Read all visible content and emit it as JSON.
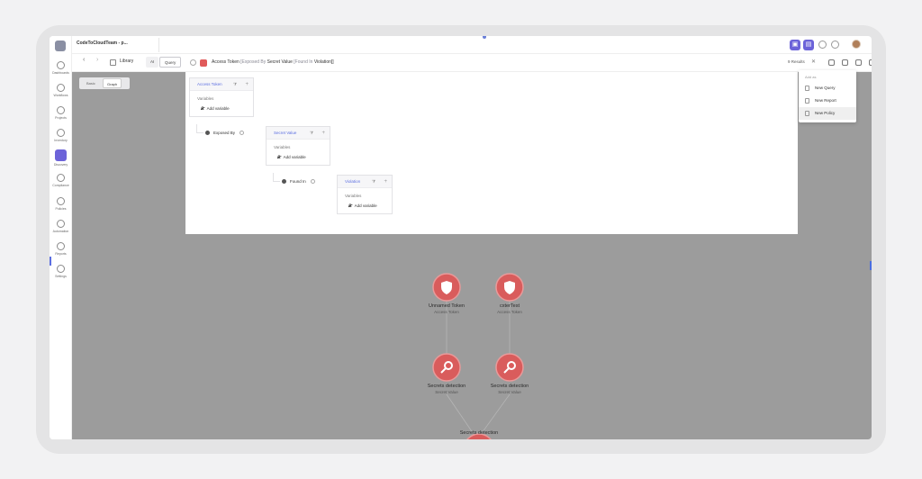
{
  "workspace": {
    "title": "CodeToCloudTeam - p..."
  },
  "sidebar": {
    "items": [
      {
        "label": "Dashboards",
        "icon": "dashboard-icon"
      },
      {
        "label": "Workflows",
        "icon": "workflow-icon"
      },
      {
        "label": "Projects",
        "icon": "projects-icon"
      },
      {
        "label": "Inventory",
        "icon": "inventory-icon"
      },
      {
        "label": "Discovery",
        "icon": "discovery-icon",
        "active": true
      },
      {
        "label": "Compliance",
        "icon": "compliance-icon"
      },
      {
        "label": "Policies",
        "icon": "policies-icon"
      },
      {
        "label": "Automation",
        "icon": "automation-icon"
      },
      {
        "label": "Reports",
        "icon": "reports-icon"
      },
      {
        "label": "Settings",
        "icon": "settings-icon"
      }
    ]
  },
  "toolbar": {
    "back": "‹",
    "forward": "›",
    "library": "Library",
    "ai": "AI",
    "query": "Query",
    "query_text": {
      "n1": "Access Token",
      "r1": "[Exposed By",
      "n2": "Secret Value",
      "r2": "[Found In",
      "n3": "Violation]]"
    },
    "results": "9 Results",
    "close": "✕"
  },
  "mode_tabs": {
    "basic": "Basic",
    "graph": "Graph"
  },
  "builder": {
    "nodes": [
      {
        "name": "Access Token",
        "variables_label": "Variables",
        "add_label": "Add variable"
      },
      {
        "name": "Secret Value",
        "variables_label": "Variables",
        "add_label": "Add variable"
      },
      {
        "name": "Violation",
        "variables_label": "Variables",
        "add_label": "Add variable"
      }
    ],
    "relations": [
      "Exposed By",
      "Found In"
    ]
  },
  "dropdown": {
    "title": "Add as",
    "items": [
      "New Query",
      "New Report",
      "New Policy"
    ]
  },
  "graph": {
    "nodes": [
      {
        "label": "Unnamed Token",
        "sub": "Access Token",
        "icon": "shield-icon"
      },
      {
        "label": "cxterTest",
        "sub": "Access Token",
        "icon": "shield-icon"
      },
      {
        "label": "Secrets detection",
        "sub": "Secret Value",
        "icon": "key-icon"
      },
      {
        "label": "Secrets detection",
        "sub": "Secret Value",
        "icon": "key-icon"
      },
      {
        "label": "Secrets detection",
        "sub": "",
        "icon": "fire-icon"
      }
    ]
  },
  "colors": {
    "accent": "#6c63d9",
    "node_red": "#d95c5c",
    "canvas": "#9c9c9c"
  }
}
